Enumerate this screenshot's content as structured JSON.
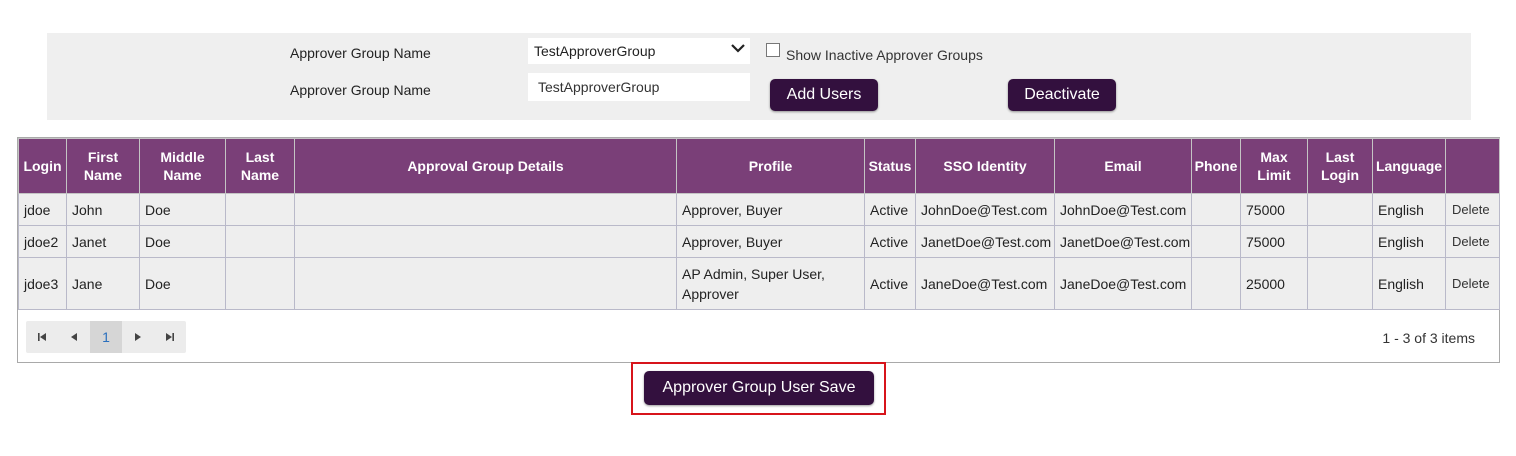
{
  "filter": {
    "select_label": "Approver Group Name",
    "selected_group": "TestApproverGroup",
    "show_inactive_label": "Show Inactive Approver Groups",
    "name_label": "Approver Group Name",
    "name_value": "TestApproverGroup",
    "add_users_label": "Add Users",
    "deactivate_label": "Deactivate"
  },
  "grid": {
    "headers": {
      "login": "Login",
      "first_name": "First Name",
      "middle_name": "Middle Name",
      "last_name": "Last Name",
      "approval_group_details": "Approval Group Details",
      "profile": "Profile",
      "status": "Status",
      "sso_identity": "SSO Identity",
      "email": "Email",
      "phone": "Phone",
      "max_limit": "Max Limit",
      "last_login": "Last Login",
      "language": "Language"
    },
    "rows": [
      {
        "login": "jdoe",
        "first": "John",
        "middle": "Doe",
        "last": "",
        "details": "",
        "profile": "Approver, Buyer",
        "status": "Active",
        "sso": "JohnDoe@Test.com",
        "email": "JohnDoe@Test.com",
        "phone": "",
        "max_limit": "75000",
        "last_login": "",
        "language": "English",
        "delete": "Delete"
      },
      {
        "login": "jdoe2",
        "first": "Janet",
        "middle": "Doe",
        "last": "",
        "details": "",
        "profile": "Approver, Buyer",
        "status": "Active",
        "sso": "JanetDoe@Test.com",
        "email": "JanetDoe@Test.com",
        "phone": "",
        "max_limit": "75000",
        "last_login": "",
        "language": "English",
        "delete": "Delete"
      },
      {
        "login": "jdoe3",
        "first": "Jane",
        "middle": "Doe",
        "last": "",
        "details": "",
        "profile": "AP Admin, Super User, Approver",
        "status": "Active",
        "sso": "JaneDoe@Test.com",
        "email": "JaneDoe@Test.com",
        "phone": "",
        "max_limit": "25000",
        "last_login": "",
        "language": "English",
        "delete": "Delete"
      }
    ]
  },
  "pager": {
    "current_page": "1",
    "items_info": "1 - 3 of 3 items",
    "first_icon": "first-page-icon",
    "prev_icon": "prev-page-icon",
    "next_icon": "next-page-icon",
    "last_icon": "last-page-icon"
  },
  "save_label": "Approver Group User Save",
  "colors": {
    "header_bg": "#7a3f78",
    "button_bg": "#33103e",
    "highlight_border": "#d7141b",
    "panel_bg": "#efefef",
    "row_bg": "#eeeeee"
  }
}
